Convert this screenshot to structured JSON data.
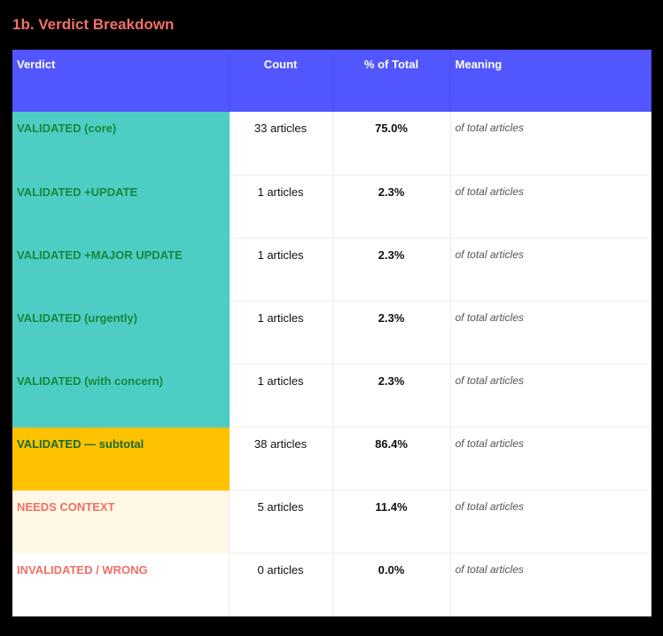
{
  "section": {
    "title": "1b. Verdict Breakdown"
  },
  "table": {
    "headers": {
      "verdict": "Verdict",
      "count": "Count",
      "percent": "% of Total",
      "meaning": "Meaning"
    },
    "rows": [
      {
        "verdict": "VALIDATED (core)",
        "count": "33 articles",
        "percent": "75.0%",
        "meaning": "of total articles",
        "kind": "validated"
      },
      {
        "verdict": "VALIDATED +UPDATE",
        "count": "1 articles",
        "percent": "2.3%",
        "meaning": "of total articles",
        "kind": "validated"
      },
      {
        "verdict": "VALIDATED +MAJOR UPDATE",
        "count": "1 articles",
        "percent": "2.3%",
        "meaning": "of total articles",
        "kind": "validated"
      },
      {
        "verdict": "VALIDATED (urgently)",
        "count": "1 articles",
        "percent": "2.3%",
        "meaning": "of total articles",
        "kind": "validated"
      },
      {
        "verdict": "VALIDATED (with concern)",
        "count": "1 articles",
        "percent": "2.3%",
        "meaning": "of total articles",
        "kind": "validated"
      },
      {
        "verdict": "VALIDATED — subtotal",
        "count": "38 articles",
        "percent": "86.4%",
        "meaning": "of total articles",
        "kind": "subtotal"
      },
      {
        "verdict": "NEEDS CONTEXT",
        "count": "5 articles",
        "percent": "11.4%",
        "meaning": "of total articles",
        "kind": "context"
      },
      {
        "verdict": "INVALIDATED / WRONG",
        "count": "0 articles",
        "percent": "0.0%",
        "meaning": "of total articles",
        "kind": "wrong"
      }
    ]
  },
  "colors": {
    "header_bg": "#5256ff",
    "validated_bg": "#4ecdc4",
    "validated_text": "#17883c",
    "subtotal_bg": "#ffc200",
    "context_bg": "#fff8e6",
    "alert_text": "#f07067"
  }
}
